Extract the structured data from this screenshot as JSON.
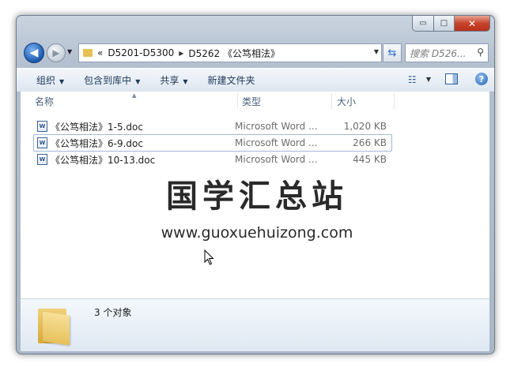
{
  "window": {
    "caption_buttons": {
      "minimize": "▭",
      "maximize": "□",
      "close": "✕"
    }
  },
  "nav": {
    "back_glyph": "◀",
    "forward_glyph": "▶",
    "address_overflow": "«",
    "breadcrumb": [
      "D5201-D5300",
      "D5262 《公笃相法》"
    ],
    "search_placeholder": "搜索 D526...",
    "icons": {
      "back": "back-arrow-icon",
      "forward": "forward-arrow-icon",
      "refresh": "refresh-icon",
      "search": "magnifier-icon"
    }
  },
  "toolbar": {
    "organize": "组织",
    "include_in_library": "包含到库中",
    "share": "共享",
    "new_folder": "新建文件夹"
  },
  "columns": {
    "name": "名称",
    "type": "类型",
    "size": "大小"
  },
  "files": [
    {
      "name": "《公笃相法》1-5.doc",
      "type": "Microsoft Word ...",
      "size": "1,020 KB",
      "focused": false
    },
    {
      "name": "《公笃相法》6-9.doc",
      "type": "Microsoft Word ...",
      "size": "266 KB",
      "focused": true
    },
    {
      "name": "《公笃相法》10-13.doc",
      "type": "Microsoft Word ...",
      "size": "445 KB",
      "focused": false
    }
  ],
  "watermark": {
    "title": "国学汇总站",
    "url": "www.guoxuehuizong.com"
  },
  "details": {
    "count": "3 个对象"
  },
  "colors": {
    "accent": "#1e395b",
    "close_button": "#c7432b",
    "folder": "#e7c05a"
  }
}
